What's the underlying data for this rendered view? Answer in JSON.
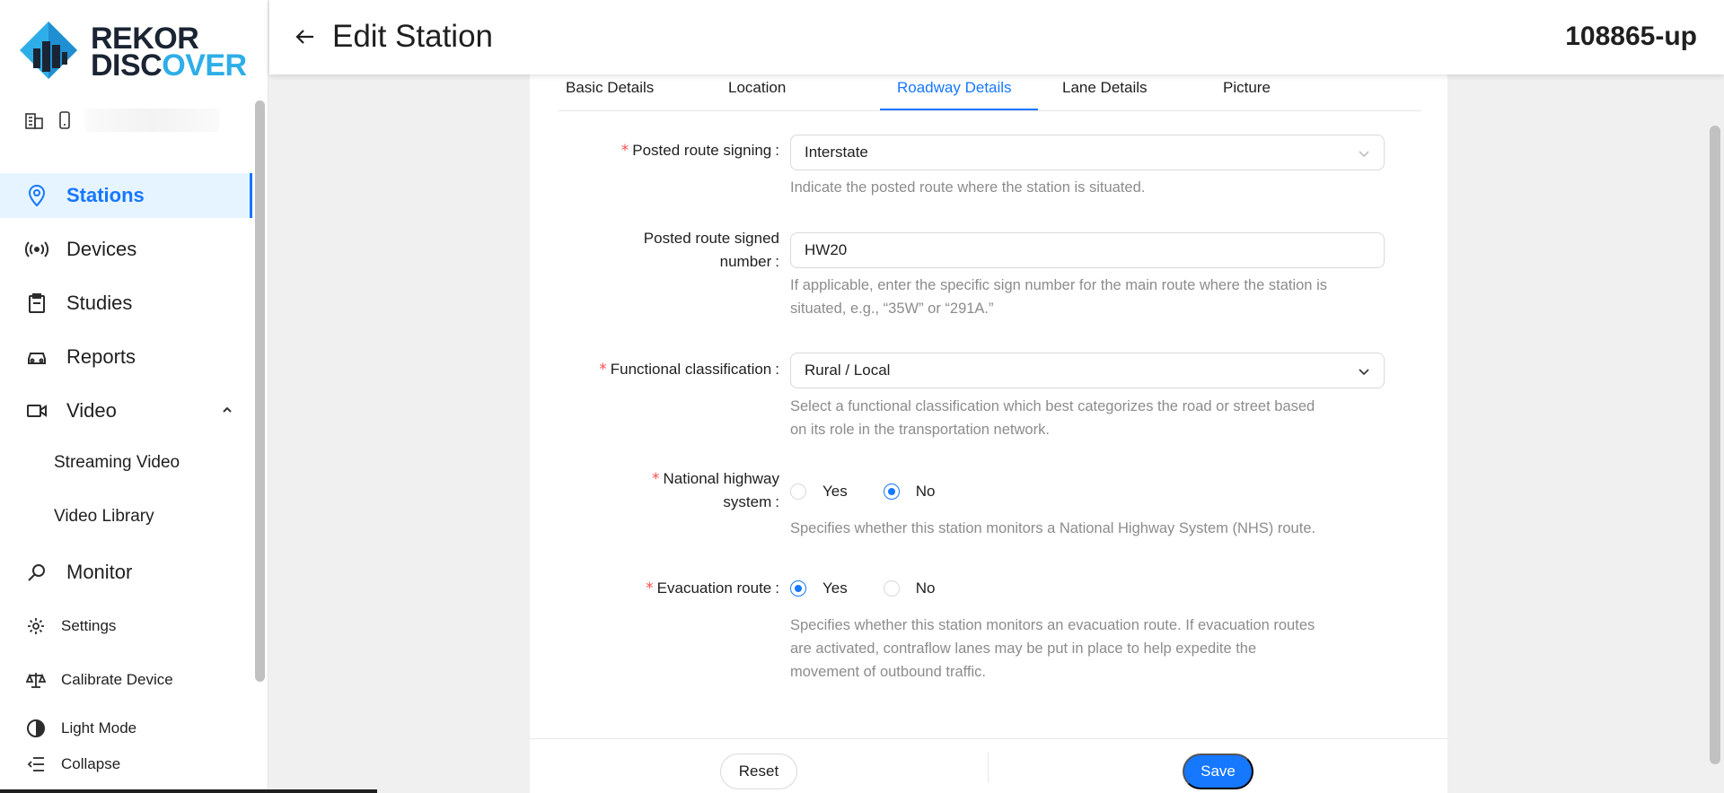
{
  "brand": {
    "line1": "REKOR",
    "line2_prefix": "DISC",
    "line2_accent": "O",
    "line2_suffix": "VER",
    "accent_color": "#2eaee8"
  },
  "sidebar": {
    "nav": [
      {
        "label": "Stations",
        "icon": "map-pin-icon",
        "active": true
      },
      {
        "label": "Devices",
        "icon": "broadcast-icon"
      },
      {
        "label": "Studies",
        "icon": "clipboard-icon"
      },
      {
        "label": "Reports",
        "icon": "car-icon"
      },
      {
        "label": "Video",
        "icon": "video-camera-icon",
        "expanded": true
      }
    ],
    "video_sub": [
      "Streaming Video",
      "Video Library"
    ],
    "monitor": "Monitor",
    "settings": "Settings",
    "calibrate": "Calibrate Device",
    "light_mode": "Light Mode",
    "collapse": "Collapse"
  },
  "header": {
    "title": "Edit Station",
    "station_id": "108865-up"
  },
  "tabs": [
    "Basic Details",
    "Location",
    "Roadway Details",
    "Lane Details",
    "Picture"
  ],
  "active_tab": "Roadway Details",
  "form": {
    "posted_route_signing": {
      "label": "Posted route signing",
      "value": "Interstate",
      "help": "Indicate the posted route where the station is situated."
    },
    "posted_route_number": {
      "label_line1": "Posted route signed",
      "label_line2": "number",
      "value": "HW20",
      "help_line1": "If applicable, enter the specific sign number for the main route where the station is",
      "help_line2": "situated, e.g., “35W” or “291A.”"
    },
    "functional_classification": {
      "label": "Functional classification",
      "value": "Rural / Local",
      "help_line1": "Select a functional classification which best categorizes the road or street based",
      "help_line2": "on its role in the transportation network."
    },
    "national_highway": {
      "label_line1": "National highway",
      "label_line2": "system",
      "yes": "Yes",
      "no": "No",
      "selected": "No",
      "help": "Specifies whether this station monitors a National Highway System (NHS) route."
    },
    "evacuation_route": {
      "label": "Evacuation route",
      "yes": "Yes",
      "no": "No",
      "selected": "Yes",
      "help_line1": "Specifies whether this station monitors an evacuation route. If evacuation routes",
      "help_line2": "are activated, contraflow lanes may be put in place to help expedite the",
      "help_line3": "movement of outbound traffic."
    }
  },
  "footer": {
    "reset": "Reset",
    "save": "Save"
  },
  "colors": {
    "primary": "#1677ff",
    "active_bg": "#e6f4ff",
    "required": "#ff4d4f"
  }
}
